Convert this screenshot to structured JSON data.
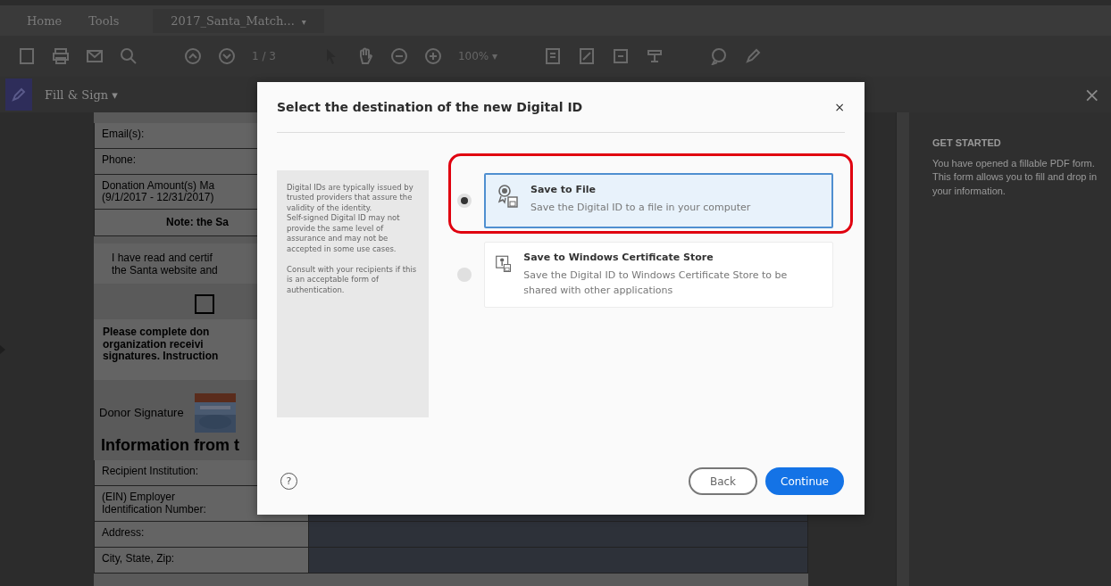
{
  "menu_bar": {
    "tabs": [
      {
        "label": "Home",
        "selected": false
      },
      {
        "label": "Tools",
        "selected": false
      },
      {
        "label": "2017_Santa_Match...",
        "selected": true
      }
    ],
    "tab_caret": "▾"
  },
  "toolbar": {
    "page_indicator": "1 / 3",
    "zoom": "100%",
    "zoom_caret": "▾"
  },
  "tool_panel": {
    "title": "Fill & Sign",
    "caret": "▾",
    "close": "×"
  },
  "form": {
    "items": [
      {
        "kind": "field",
        "label": "Email(s):"
      },
      {
        "kind": "field",
        "label": "Phone:"
      },
      {
        "kind": "field",
        "label": "Donation Amount(s) Ma\n(9/1/2017 - 12/31/2017)"
      },
      {
        "kind": "note",
        "label": "Note: the Sa"
      },
      {
        "kind": "text",
        "label": "I have read and certif\nthe Santa website and"
      },
      {
        "kind": "checkbox",
        "checked": false
      },
      {
        "kind": "instructions",
        "label": "Please complete don\norganization receivi\nsignatures. Instruction"
      },
      {
        "kind": "signature",
        "label": "Donor Signature"
      },
      {
        "kind": "heading",
        "label": "Information from t"
      },
      {
        "kind": "field",
        "label": "Recipient Institution:"
      },
      {
        "kind": "field",
        "label": "(EIN) Employer\nIdentification Number:"
      },
      {
        "kind": "field",
        "label": "Address:"
      },
      {
        "kind": "field",
        "label": "City, State, Zip:"
      }
    ]
  },
  "right_panel": {
    "heading": "GET STARTED",
    "text": "You have opened a fillable PDF form. This form allows you to fill and drop in your information."
  },
  "dialog": {
    "title": "Select the destination of the new Digital ID",
    "close": "×",
    "info": "Digital IDs are typically issued by trusted providers that assure the validity of the identity.\nSelf-signed Digital ID may not provide the same level of assurance and may not be accepted in some use cases.\n\nConsult with your recipients if this is an acceptable form of authentication.",
    "options": [
      {
        "kind": "file",
        "title": "Save to File",
        "description": "Save the Digital ID to a file in your computer",
        "selected": true
      },
      {
        "kind": "store",
        "title": "Save to Windows Certificate Store",
        "description": "Save the Digital ID to Windows Certificate Store to be shared with other applications",
        "selected": false
      }
    ],
    "help": "?",
    "buttons": [
      {
        "kind": "secondary",
        "label": "Back"
      },
      {
        "kind": "primary",
        "label": "Continue"
      }
    ]
  }
}
